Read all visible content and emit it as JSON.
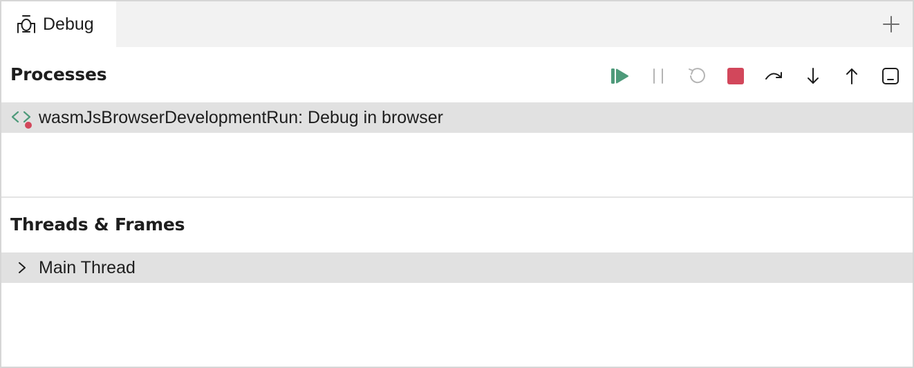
{
  "tab": {
    "label": "Debug",
    "icon": "bug-icon"
  },
  "add_tab_icon": "plus-icon",
  "processes": {
    "title": "Processes",
    "toolbar": [
      {
        "name": "resume-button",
        "icon": "resume-icon",
        "color": "#4e9a7a",
        "enabled": true
      },
      {
        "name": "pause-button",
        "icon": "pause-icon",
        "color": "#b4b4b4",
        "enabled": false
      },
      {
        "name": "restart-button",
        "icon": "restart-icon",
        "color": "#b4b4b4",
        "enabled": false
      },
      {
        "name": "stop-button",
        "icon": "stop-icon",
        "color": "#d2475b",
        "enabled": true
      },
      {
        "name": "step-over-button",
        "icon": "step-over-icon",
        "color": "#1e1e1e",
        "enabled": true
      },
      {
        "name": "step-into-button",
        "icon": "step-into-icon",
        "color": "#1e1e1e",
        "enabled": true
      },
      {
        "name": "step-out-button",
        "icon": "step-out-icon",
        "color": "#1e1e1e",
        "enabled": true
      },
      {
        "name": "console-button",
        "icon": "console-icon",
        "color": "#1e1e1e",
        "enabled": true
      }
    ],
    "items": [
      {
        "label": "wasmJsBrowserDevelopmentRun: Debug in browser",
        "icon": "code-debug-icon"
      }
    ]
  },
  "threads": {
    "title": "Threads & Frames",
    "items": [
      {
        "label": "Main Thread",
        "icon": "chevron-right-icon"
      }
    ]
  },
  "colors": {
    "accent_green": "#4e9a7a",
    "stop_red": "#d2475b",
    "selected_row": "#e1e1e1",
    "tabbar_bg": "#f2f2f2"
  }
}
